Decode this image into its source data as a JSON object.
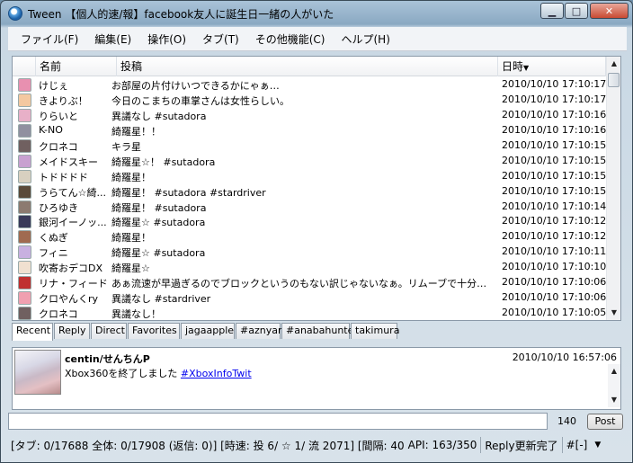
{
  "window": {
    "title": "Tween  【個人的速/報】facebook友人に誕生日一緒の人がいた"
  },
  "menu": [
    "ファイル(F)",
    "編集(E)",
    "操作(O)",
    "タブ(T)",
    "その他機能(C)",
    "ヘルプ(H)"
  ],
  "list": {
    "columns": {
      "name": "名前",
      "post": "投稿",
      "date": "日時"
    },
    "rows": [
      {
        "name": "けじぇ",
        "post": "お部屋の片付けいつできるかにゃぁ…",
        "date": "2010/10/10 17:10:17",
        "avatar": "#e890b0"
      },
      {
        "name": "きよりぶ！",
        "post": "今日のこまちの車掌さんは女性らしい。",
        "date": "2010/10/10 17:10:17",
        "avatar": "#f4c8a0"
      },
      {
        "name": "りらいと",
        "post": "異議なし #sutadora",
        "date": "2010/10/10 17:10:16",
        "avatar": "#e8b0c8"
      },
      {
        "name": "K-NO",
        "post": "綺羅星！！",
        "date": "2010/10/10 17:10:16",
        "avatar": "#9090a0"
      },
      {
        "name": "クロネコ",
        "post": "キラ星",
        "date": "2010/10/10 17:10:15",
        "avatar": "#706060"
      },
      {
        "name": "メイドスキー",
        "post": "綺羅星☆！ #sutadora",
        "date": "2010/10/10 17:10:15",
        "avatar": "#c8a0d0"
      },
      {
        "name": "トドドドド",
        "post": "綺羅星！",
        "date": "2010/10/10 17:10:15",
        "avatar": "#d8d0c0"
      },
      {
        "name": "うらてん☆綺...",
        "post": "綺羅星！ #sutadora #stardriver",
        "date": "2010/10/10 17:10:15",
        "avatar": "#5a4a3a"
      },
      {
        "name": "ひろゆき",
        "post": "綺羅星！ #sutadora",
        "date": "2010/10/10 17:10:14",
        "avatar": "#8c7a70"
      },
      {
        "name": "銀河イーノッ...",
        "post": "綺羅星☆ #sutadora",
        "date": "2010/10/10 17:10:12",
        "avatar": "#3a3a5a"
      },
      {
        "name": "くぬぎ",
        "post": "綺羅星！",
        "date": "2010/10/10 17:10:12",
        "avatar": "#a06a50"
      },
      {
        "name": "フィニ",
        "post": "綺羅星☆ #sutadora",
        "date": "2010/10/10 17:10:11",
        "avatar": "#c8b0e0"
      },
      {
        "name": "吹寄おデコDX",
        "post": "綺羅星☆",
        "date": "2010/10/10 17:10:10",
        "avatar": "#f0e0d0"
      },
      {
        "name": "リナ・フィード",
        "post": "あぁ流速が早過ぎるのでブロックというのもない訳じゃないなぁ。リムーブで十分なんだけど、…",
        "date": "2010/10/10 17:10:06",
        "avatar": "#c03030"
      },
      {
        "name": "クロやんくry",
        "post": "異議なし #stardriver",
        "date": "2010/10/10 17:10:06",
        "avatar": "#f0a0b0"
      },
      {
        "name": "クロネコ",
        "post": "異議なし！",
        "date": "2010/10/10 17:10:05",
        "avatar": "#706060"
      }
    ]
  },
  "tabs": [
    "Recent",
    "Reply",
    "Direct",
    "Favorites",
    "jagaapple",
    "#aznyan",
    "#anabahunter",
    "takimura"
  ],
  "detail": {
    "name": "centin/せんちんP",
    "date": "2010/10/10 16:57:06",
    "text": "Xbox360を終了しました ",
    "hashtag": "#XboxInfoTwit"
  },
  "composer": {
    "value": "",
    "char_count": "140",
    "post_label": "Post"
  },
  "status": {
    "main": "[タブ: 0/17688 全体: 0/17908 (返信: 0)] [時速: 投 6/ ☆ 1/ 流 2071] [間隔: 40",
    "api": "API: 163/350",
    "message": "Reply更新完了",
    "filter": "#[-]"
  },
  "colors": {
    "accent": "#1e62a8",
    "link": "#0000ee"
  }
}
